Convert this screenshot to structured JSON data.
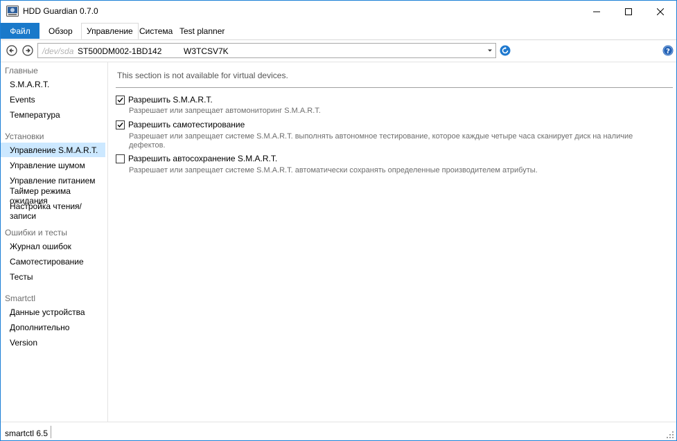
{
  "window": {
    "title": "HDD Guardian 0.7.0"
  },
  "menu": {
    "file": "Файл",
    "tabs": [
      {
        "label": "Обзор"
      },
      {
        "label": "Управление"
      },
      {
        "label": "Система"
      },
      {
        "label": "Test planner"
      }
    ],
    "active_tab": "Управление"
  },
  "toolbar": {
    "device_path": "/dev/sda",
    "device_model": "ST500DM002-1BD142",
    "device_serial": "W3TCSV7K"
  },
  "sidebar": {
    "groups": [
      {
        "header": "Главные",
        "items": [
          "S.M.A.R.T.",
          "Events",
          "Температура"
        ]
      },
      {
        "header": "Установки",
        "items": [
          "Управление S.M.A.R.T.",
          "Управление шумом",
          "Управление питанием",
          "Таймер режима ожидания",
          "Настройка чтения/записи"
        ]
      },
      {
        "header": "Ошибки и тесты",
        "items": [
          "Журнал ошибок",
          "Самотестирование",
          "Тесты"
        ]
      },
      {
        "header": "Smartctl",
        "items": [
          "Данные устройства",
          "Дополнительно",
          "Version"
        ]
      }
    ],
    "selected": "Управление S.M.A.R.T."
  },
  "main": {
    "notice": "This section is not available for virtual devices.",
    "options": [
      {
        "label": "Разрешить S.M.A.R.T.",
        "checked": true,
        "description": "Разрешает или запрещает автомониторинг S.M.A.R.T."
      },
      {
        "label": "Разрешить самотестирование",
        "checked": true,
        "description": "Разрешает или запрещает системе S.M.A.R.T. выполнять автономное тестирование, которое каждые четыре часа сканирует диск на наличие дефектов."
      },
      {
        "label": "Разрешить автосохранение S.M.A.R.T.",
        "checked": false,
        "description": "Разрешает или запрещает системе S.M.A.R.T. автоматически сохранять определенные производителем атрибуты."
      }
    ]
  },
  "statusbar": {
    "text": "smartctl 6.5"
  },
  "colors": {
    "accent": "#1979ca",
    "selection": "#cce8ff",
    "border": "#1b7fd6"
  }
}
